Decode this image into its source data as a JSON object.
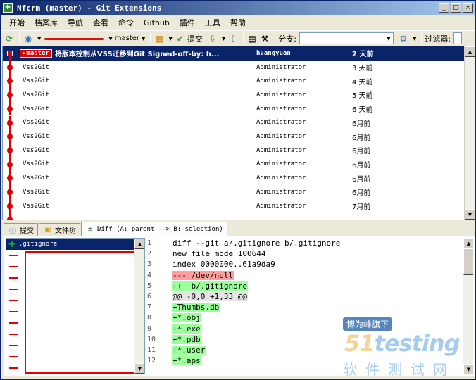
{
  "window": {
    "title": "Nfcrm (master) - Git Extensions",
    "min_label": "_",
    "max_label": "□",
    "close_label": "×"
  },
  "menu": [
    "开始",
    "档案库",
    "导航",
    "查看",
    "命令",
    "Github",
    "插件",
    "工具",
    "帮助"
  ],
  "toolbar": {
    "branch": "master",
    "commit_label": "提交",
    "branch_field_label": "分支:",
    "filter_label": "过滤器:"
  },
  "commits": [
    {
      "tag": "master",
      "message": "将版本控制从VSS迁移到Git Signed-off-by: h...",
      "author": "huangyuan",
      "date": "2 天前",
      "selected": true
    },
    {
      "message": "Vss2Git",
      "author": "Administrator",
      "date": "3 天前"
    },
    {
      "message": "Vss2Git",
      "author": "Administrator",
      "date": "4 天前"
    },
    {
      "message": "Vss2Git",
      "author": "Administrator",
      "date": "5 天前"
    },
    {
      "message": "Vss2Git",
      "author": "Administrator",
      "date": "6 天前"
    },
    {
      "message": "Vss2Git",
      "author": "Administrator",
      "date": "6月前"
    },
    {
      "message": "Vss2Git",
      "author": "Administrator",
      "date": "6月前"
    },
    {
      "message": "Vss2Git",
      "author": "Administrator",
      "date": "6月前"
    },
    {
      "message": "Vss2Git",
      "author": "Administrator",
      "date": "6月前"
    },
    {
      "message": "Vss2Git",
      "author": "Administrator",
      "date": "6月前"
    },
    {
      "message": "Vss2Git",
      "author": "Administrator",
      "date": "6月前"
    },
    {
      "message": "Vss2Git",
      "author": "Administrator",
      "date": "7月前"
    }
  ],
  "tabs": [
    {
      "label": "提交",
      "icon": "info-icon"
    },
    {
      "label": "文件树",
      "icon": "folder-tree-icon"
    },
    {
      "label": "Diff (A: parent --> B: selection)",
      "icon": "diff-icon",
      "active": true
    }
  ],
  "files": [
    {
      "name": ".gitignore",
      "status": "added",
      "selected": true
    },
    {
      "status": "deleted"
    },
    {
      "status": "deleted"
    },
    {
      "status": "deleted"
    },
    {
      "status": "deleted"
    },
    {
      "status": "deleted"
    },
    {
      "status": "deleted"
    },
    {
      "status": "deleted"
    },
    {
      "status": "deleted"
    },
    {
      "status": "deleted"
    },
    {
      "status": "deleted"
    },
    {
      "status": "deleted"
    }
  ],
  "diff_lines": [
    {
      "n": "1",
      "text": "diff --git a/.gitignore b/.gitignore",
      "kind": "plain"
    },
    {
      "n": "2",
      "text": "new file mode 100644",
      "kind": "plain"
    },
    {
      "n": "3",
      "text": "index 0000000..61a9da9",
      "kind": "plain"
    },
    {
      "n": "4",
      "text": "--- /dev/null",
      "kind": "removed"
    },
    {
      "n": "5",
      "text": "+++ b/.gitignore",
      "kind": "added"
    },
    {
      "n": "6",
      "text": "@@ -0,0 +1,33 @@",
      "kind": "hunk"
    },
    {
      "n": "7",
      "text": "+Thumbs.db",
      "kind": "added"
    },
    {
      "n": "8",
      "text": "+*.obj",
      "kind": "added"
    },
    {
      "n": "9",
      "text": "+*.exe",
      "kind": "added"
    },
    {
      "n": "10",
      "text": "+*.pdb",
      "kind": "added"
    },
    {
      "n": "11",
      "text": "+*.user",
      "kind": "added"
    },
    {
      "n": "12",
      "text": "+*.aps",
      "kind": "added"
    }
  ],
  "watermark": {
    "top": "博为峰旗下",
    "logo_num": "51",
    "logo_text": "testing",
    "sub": "软件测试网"
  },
  "colors": {
    "graph": "#e00000",
    "selection": "#0a246a",
    "diff_removed": "#ff9c9c",
    "diff_added": "#9cff9c"
  }
}
